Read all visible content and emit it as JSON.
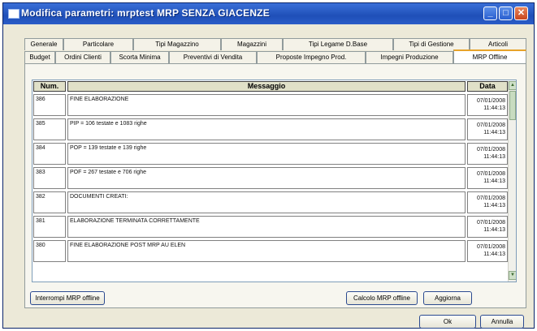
{
  "window": {
    "title": "Modifica parametri: mrptest MRP SENZA GIACENZE"
  },
  "tabs_row1": [
    "Generale",
    "Particolare",
    "Tipi Magazzino",
    "Magazzini",
    "Tipi Legame D.Base",
    "Tipi di Gestione",
    "Articoli"
  ],
  "tabs_row2": [
    "Budget",
    "Ordini Clienti",
    "Scorta Minima",
    "Preventivi di Vendita",
    "Proposte Impegno Prod.",
    "Impegni Produzione",
    "MRP Offline"
  ],
  "active_tab": "MRP Offline",
  "grid": {
    "headers": {
      "num": "Num.",
      "msg": "Messaggio",
      "date": "Data"
    },
    "rows": [
      {
        "num": "386",
        "msg": "FINE ELABORAZIONE",
        "date": "07/01/2008",
        "time": "11:44:13"
      },
      {
        "num": "385",
        "msg": "PIP = 106 testate e 1083 righe",
        "date": "07/01/2008",
        "time": "11:44:13"
      },
      {
        "num": "384",
        "msg": "POP = 139 testate e 139 righe",
        "date": "07/01/2008",
        "time": "11:44:13"
      },
      {
        "num": "383",
        "msg": "POF = 267 testate e 706 righe",
        "date": "07/01/2008",
        "time": "11:44:13"
      },
      {
        "num": "382",
        "msg": "DOCUMENTI CREATI:",
        "date": "07/01/2008",
        "time": "11:44:13"
      },
      {
        "num": "381",
        "msg": "ELABORAZIONE TERMINATA CORRETTAMENTE",
        "date": "07/01/2008",
        "time": "11:44:13"
      },
      {
        "num": "380",
        "msg": "FINE ELABORAZIONE POST MRP AU ELEN",
        "date": "07/01/2008",
        "time": "11:44:13"
      }
    ]
  },
  "buttons": {
    "interrompi": "Interrompi MRP offline",
    "calcolo": "Calcolo MRP offline",
    "aggiorna": "Aggiorna",
    "ok": "Ok",
    "annulla": "Annulla"
  }
}
